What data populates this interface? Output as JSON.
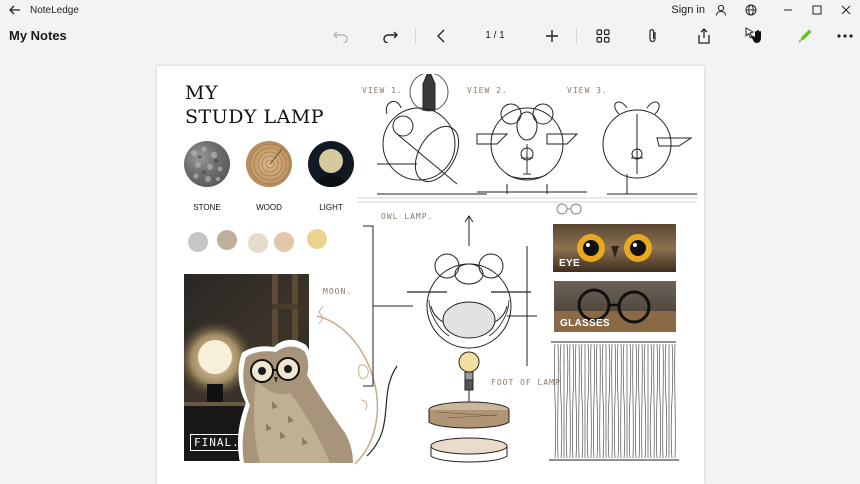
{
  "titlebar": {
    "app_name": "NoteLedge",
    "sign_in": "Sign in"
  },
  "toolbar": {
    "doc_title": "My Notes",
    "page_indicator": "1 / 1",
    "pen_color": "#6bbf2a"
  },
  "board": {
    "title_line1": "MY",
    "title_line2": "STUDY LAMP",
    "materials": [
      {
        "label": "STONE"
      },
      {
        "label": "WOOD"
      },
      {
        "label": "LIGHT"
      }
    ],
    "palette": [
      "#c8c6c4",
      "#bfae9c",
      "#e6dacb",
      "#e2c7ab",
      "#ead38f"
    ],
    "sketch_notes": {
      "view1": "VIEW 1.",
      "view2": "VIEW 2.",
      "view3": "VIEW 3.",
      "owl_lamp": "OWL LAMP.",
      "moon": "MOON.",
      "foot": "FOOT OF LAMP",
      "final": "FINAL."
    },
    "photo_labels": {
      "eye": "EYE",
      "glasses": "GLASSES"
    }
  }
}
